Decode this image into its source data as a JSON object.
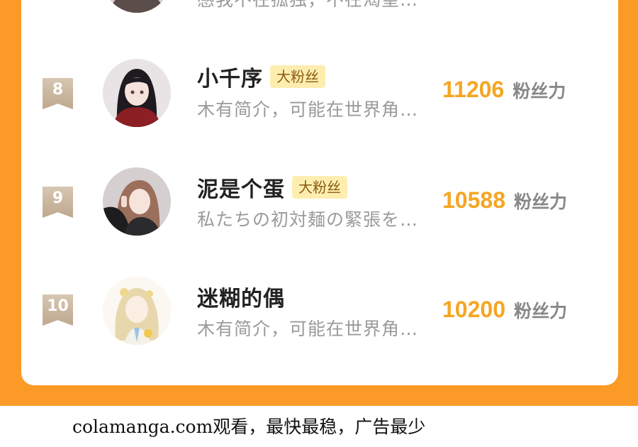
{
  "ranking": {
    "partial_row": {
      "bio": "感我不在孤独，不在渴望…"
    },
    "rows": [
      {
        "rank": "8",
        "name": "小千序",
        "tag": "大粉丝",
        "bio": "木有简介，可能在世界角…",
        "score": "11206",
        "score_unit": "粉丝力"
      },
      {
        "rank": "9",
        "name": "泥是个蛋",
        "tag": "大粉丝",
        "bio": "私たちの初対麺の緊張を…",
        "score": "10588",
        "score_unit": "粉丝力"
      },
      {
        "rank": "10",
        "name": "迷糊的偶",
        "tag": "",
        "bio": "木有简介，可能在世界角…",
        "score": "10200",
        "score_unit": "粉丝力"
      }
    ]
  },
  "footer": {
    "watermark": "colamanga.com观看，最快最稳，广告最少"
  },
  "colors": {
    "frame": "#fb9a26",
    "score": "#f5a623",
    "tag_bg": "#fdeeb0"
  }
}
